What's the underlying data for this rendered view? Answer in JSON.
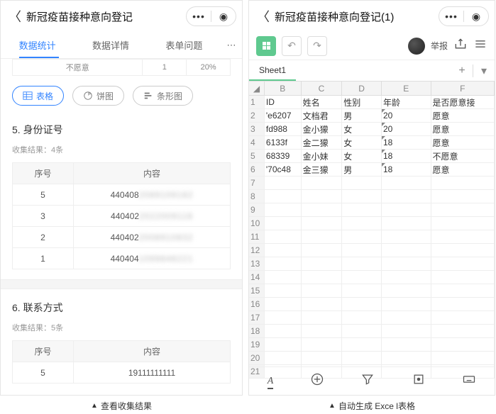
{
  "left": {
    "header_title": "新冠疫苗接种意向登记",
    "tabs": [
      "数据统计",
      "数据详情",
      "表单问题"
    ],
    "mini": {
      "label": "不愿意",
      "count": "1",
      "pct": "20%"
    },
    "chart_btns": {
      "table": "表格",
      "pie": "饼图",
      "bar": "条形图"
    },
    "sec5": {
      "title": "5. 身份证号",
      "sub": "收集结果：4条"
    },
    "tbl5_head": {
      "a": "序号",
      "b": "内容"
    },
    "tbl5_rows": [
      {
        "n": "5",
        "v": "440408",
        "blur": "2089109182"
      },
      {
        "n": "3",
        "v": "440402",
        "blur": "2022009118"
      },
      {
        "n": "2",
        "v": "440402",
        "blur": "2008910832"
      },
      {
        "n": "1",
        "v": "440404",
        "blur": "1099848221"
      }
    ],
    "sec6": {
      "title": "6. 联系方式",
      "sub": "收集结果：5条"
    },
    "tbl6_head": {
      "a": "序号",
      "b": "内容"
    },
    "tbl6_row": {
      "n": "5",
      "v": "19111111111"
    }
  },
  "right": {
    "header_title": "新冠疫苗接种意向登记(1)",
    "report": "举报",
    "sheet": "Sheet1",
    "cols": [
      "B",
      "C",
      "D",
      "E",
      "F"
    ],
    "head": {
      "b": "ID",
      "c": "姓名",
      "d": "性别",
      "e": "年龄",
      "f": "是否愿意接"
    },
    "rows": [
      {
        "b": "'e6207",
        "c": "文档君",
        "d": "男",
        "e": "20",
        "f": "愿意"
      },
      {
        "b": "fd988",
        "c": "金小獴",
        "d": "女",
        "e": "20",
        "f": "愿意"
      },
      {
        "b": "6133f",
        "c": "金二獴",
        "d": "女",
        "e": "18",
        "f": "愿意"
      },
      {
        "b": "68339",
        "c": "金小妹",
        "d": "女",
        "e": "18",
        "f": "不愿意"
      },
      {
        "b": "'70c48",
        "c": "金三獴",
        "d": "男",
        "e": "18",
        "f": "愿意"
      }
    ],
    "rownums": [
      "1",
      "2",
      "3",
      "4",
      "5",
      "6",
      "7",
      "8",
      "9",
      "10",
      "11",
      "12",
      "13",
      "14",
      "15",
      "16",
      "17",
      "18",
      "19",
      "20",
      "21"
    ]
  },
  "captions": {
    "left": "查看收集结果",
    "right": "自动生成 Exce l表格"
  }
}
